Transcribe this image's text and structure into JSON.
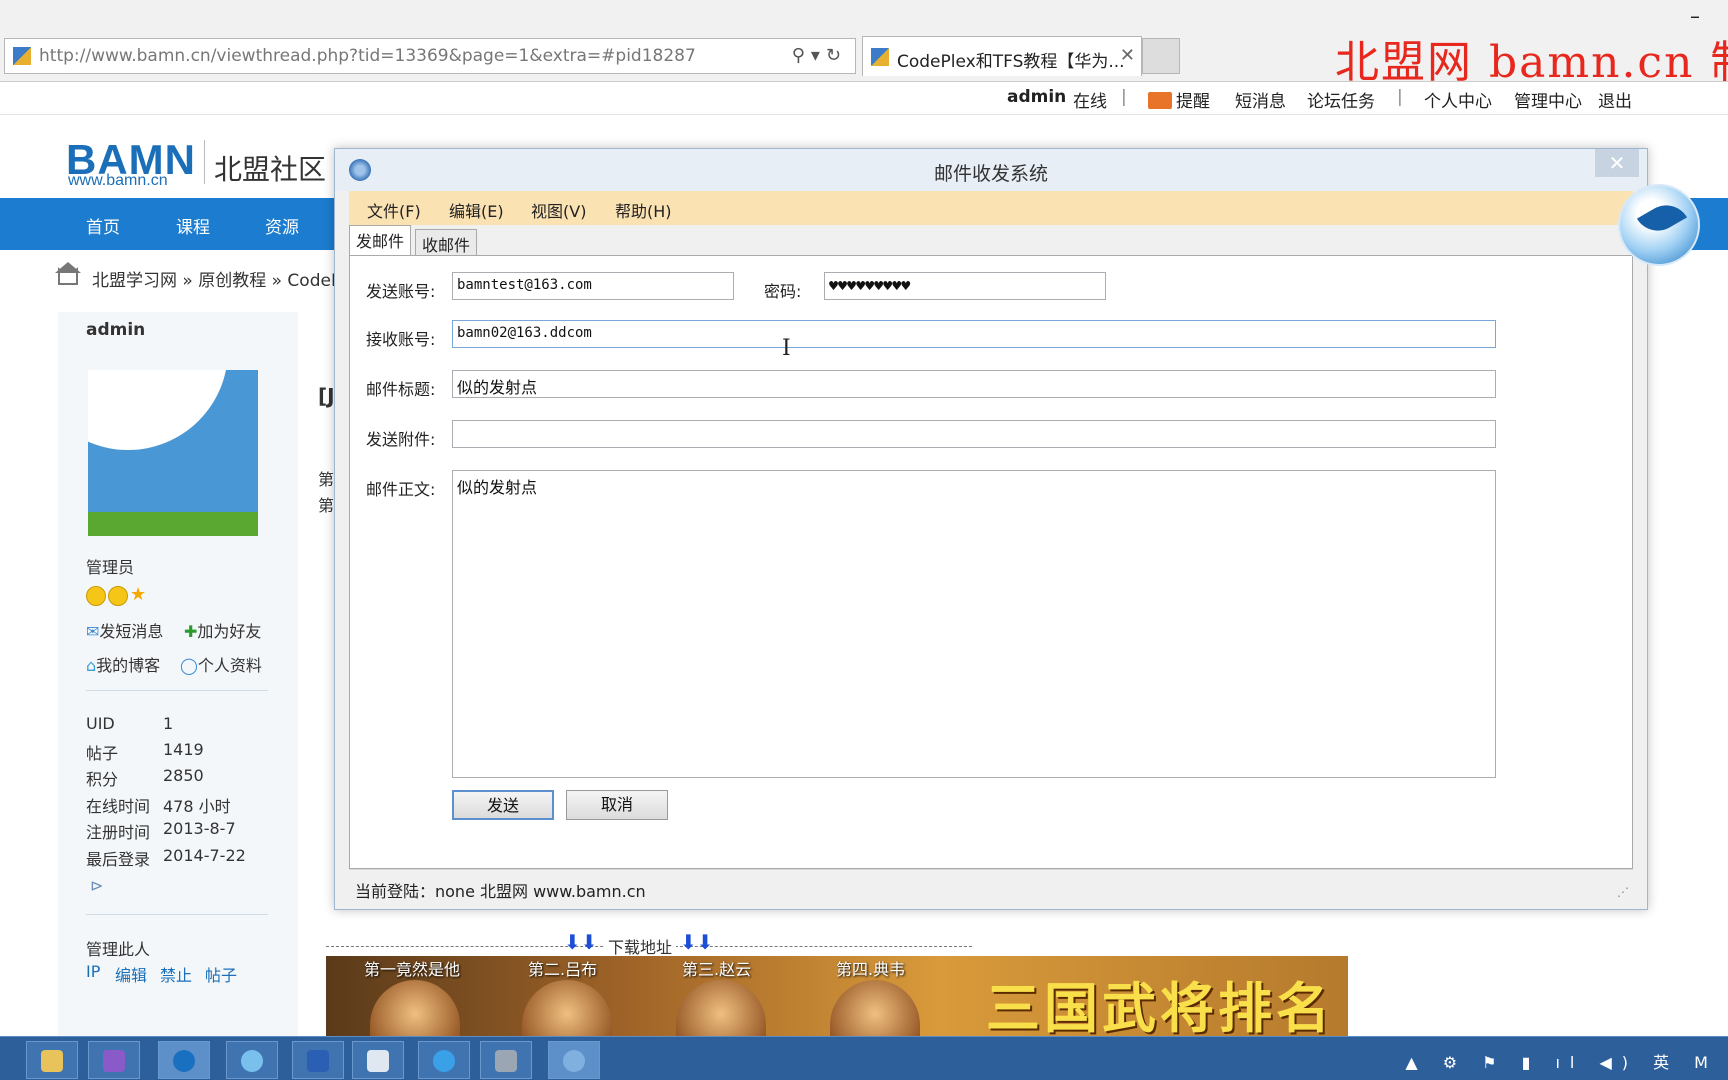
{
  "browser": {
    "url": "http://www.bamn.cn/viewthread.php?tid=13369&page=1&extra=#pid18287",
    "tab_title": "CodePlex和TFS教程【华为...",
    "tab_close": "✕",
    "tools": "⚲▾↻",
    "minimize": "–"
  },
  "watermark": "北盟网 bamn.cn 制",
  "userbar": {
    "username": "admin",
    "online": "在线",
    "sep1": "|",
    "remind": "提醒",
    "messages": "短消息",
    "tasks": "论坛任务",
    "sep2": "|",
    "profile": "个人中心",
    "admin_center": "管理中心",
    "logout": "退出"
  },
  "site": {
    "logo": "BAMN",
    "logo_sub": "www.bamn.cn",
    "title": "北盟社区"
  },
  "nav": [
    "首页",
    "课程",
    "资源"
  ],
  "breadcrumb": "北盟学习网 » 原创教程 » CodeP",
  "sidebar": {
    "username": "admin",
    "role": "管理员",
    "send_message": "发短消息",
    "add_friend": "加为好友",
    "blog": "我的博客",
    "profile": "个人资料",
    "stats": [
      {
        "label": "UID",
        "value": "1"
      },
      {
        "label": "帖子",
        "value": "1419"
      },
      {
        "label": "积分",
        "value": "2850"
      },
      {
        "label": "在线时间",
        "value": "478 小时"
      },
      {
        "label": "注册时间",
        "value": "2013-8-7"
      },
      {
        "label": "最后登录",
        "value": "2014-7-22"
      }
    ],
    "manage_title": "管理此人",
    "manage_links": [
      "IP",
      "编辑",
      "禁止",
      "帖子"
    ]
  },
  "main_fragments": [
    "[J",
    "第",
    "第"
  ],
  "dialog": {
    "title": "邮件收发系统",
    "close": "✕",
    "menu": [
      "文件(F)",
      "编辑(E)",
      "视图(V)",
      "帮助(H)"
    ],
    "tabs": [
      "发邮件",
      "收邮件"
    ],
    "form": {
      "sender_label": "发送账号:",
      "sender_value": "bamntest@163.com",
      "password_label": "密码:",
      "password_value": "♥♥♥♥♥♥♥♥♥",
      "receiver_label": "接收账号:",
      "receiver_value": "bamn02@163.ddcom",
      "subject_label": "邮件标题:",
      "subject_value": "似的发射点",
      "attachment_label": "发送附件:",
      "attachment_value": "",
      "body_label": "邮件正文:",
      "body_value": "似的发射点"
    },
    "send_button": "发送",
    "cancel_button": "取消",
    "status": "当前登陆：none   北盟网 www.bamn.cn",
    "grip": "⋰"
  },
  "download": {
    "arrows_left": "⬇⬇",
    "text": "下载地址",
    "arrows_right": "⬇⬇"
  },
  "banner": {
    "heroes": [
      "第一竟然是他",
      "第二.吕布",
      "第三.赵云",
      "第四.典韦"
    ],
    "title": "三国武将排名"
  },
  "taskbar": {
    "tray": "▲ ⚙ ⚑ ▮ ıl ◀) 英 M"
  },
  "colors": {
    "nav": "#1c7ccf",
    "menubar": "#fbe2b3",
    "watermark": "#e8281e",
    "taskbar": "#2d5f9a"
  }
}
